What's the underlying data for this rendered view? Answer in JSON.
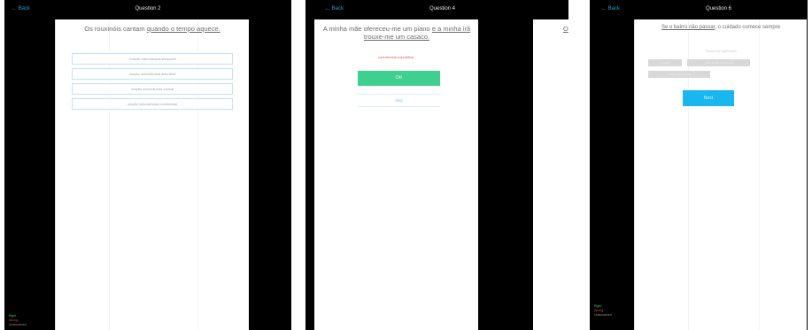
{
  "screen1": {
    "back_label": "Back",
    "title": "Question 2",
    "prompt_before": "Os rouxinóis cantam",
    "prompt_underlined": "quando o tempo aquece.",
    "options": [
      "Oração subordinada temporal",
      "oração subordinada adverbial",
      "oração subordinada causal",
      "oração subordinada condicional"
    ],
    "legend": [
      "Right",
      "Wrong",
      "Unanswered"
    ]
  },
  "screen2": {
    "back_label": "Back",
    "title": "Question 4",
    "prompt_before": "A minha mãe ofereceu-me um piano",
    "prompt_underlined": "e a minha irã trouxe-me um casaco.",
    "answer_text": "coordenada copulativa",
    "ok_label": "Ok!",
    "skip_label": "Skip",
    "peek_text": "O"
  },
  "screen3": {
    "back_label": "Back",
    "title": "Question 6",
    "prompt_underlined": "Se o bairro não passar",
    "prompt_after": ", o cuidado comece sempre",
    "hint": "Choose the right words",
    "chips": [
      "oração",
      "subordinada condicional",
      "oração subordinada"
    ],
    "next_label": "Next",
    "accent": "#19b6f0",
    "legend": [
      "Right",
      "Wrong",
      "Unanswered"
    ]
  },
  "colors": {
    "ok_green": "#3fd08f",
    "accent_blue": "#19b6f0"
  }
}
